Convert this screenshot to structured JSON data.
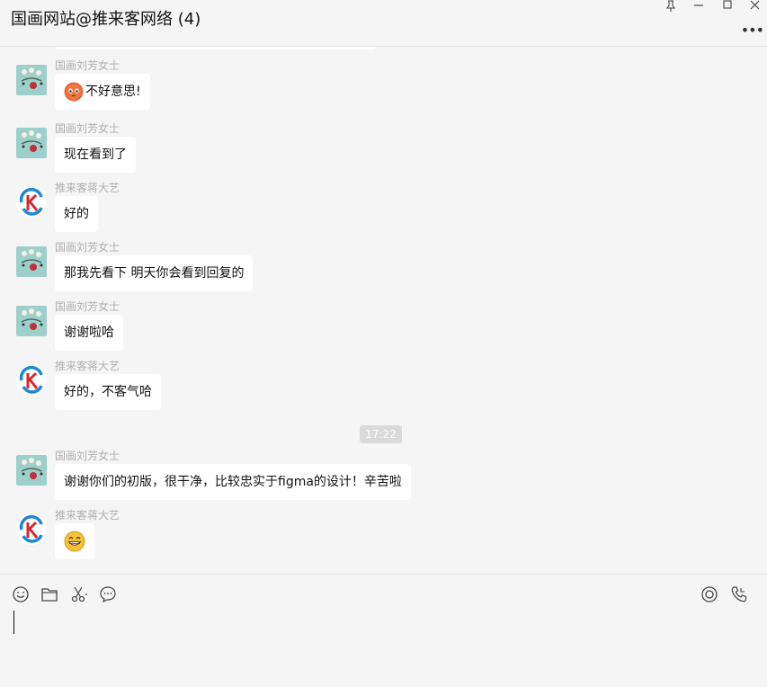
{
  "window": {
    "title": "国画网站@推来客网络 (4)"
  },
  "messages": [
    {
      "sender": "国画刘芳女士",
      "text": "不好意思!",
      "avatar": "flower-avatar",
      "emoji": "blush-emoji"
    },
    {
      "sender": "国画刘芳女士",
      "text": "现在看到了",
      "avatar": "flower-avatar"
    },
    {
      "sender": "推来客蒋大艺",
      "text": "好的",
      "avatar": "logo-avatar"
    },
    {
      "sender": "国画刘芳女士",
      "text": "那我先看下 明天你会看到回复的",
      "avatar": "flower-avatar"
    },
    {
      "sender": "国画刘芳女士",
      "text": "谢谢啦哈",
      "avatar": "flower-avatar"
    },
    {
      "sender": "推来客蒋大艺",
      "text": "好的，不客气哈",
      "avatar": "logo-avatar"
    },
    {
      "sender": "国画刘芳女士",
      "text": "谢谢你们的初版，很干净，比较忠实于figma的设计！辛苦啦",
      "avatar": "flower-avatar"
    },
    {
      "sender": "推来客蒋大艺",
      "text": "",
      "avatar": "logo-avatar",
      "emoji": "grin-emoji"
    }
  ],
  "timestamp": "17:22",
  "toolbar": {
    "left_icons": [
      "emoji-icon",
      "folder-icon",
      "scissors-icon",
      "chat-bubble-icon"
    ],
    "right_icons": [
      "live-icon",
      "phone-icon"
    ]
  },
  "colors": {
    "background": "#f5f5f5",
    "bubble": "#ffffff",
    "sender": "#b0b0b0",
    "brand_blue": "#1e88d8",
    "brand_red": "#d8262e"
  }
}
